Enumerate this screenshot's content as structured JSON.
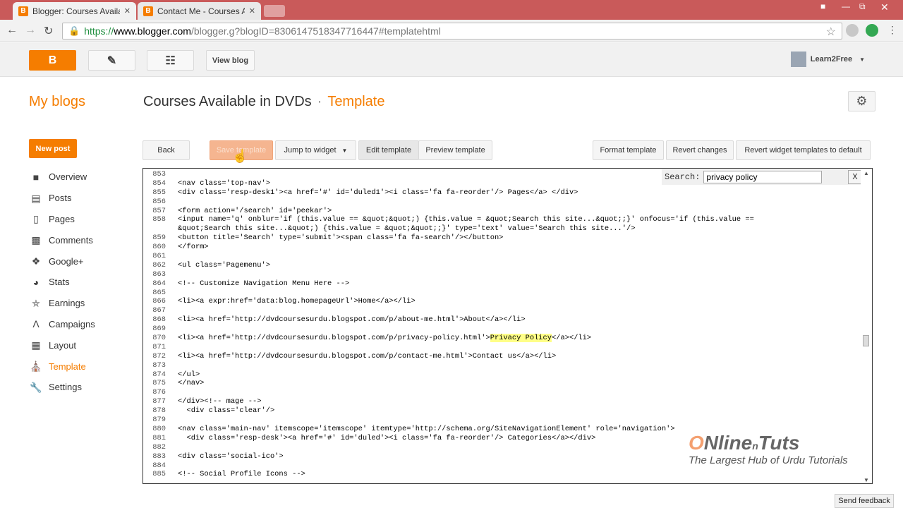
{
  "browser": {
    "tabs": [
      {
        "label": "Blogger: Courses Availabl",
        "active": true
      },
      {
        "label": "Contact Me - Courses Ava",
        "active": false
      }
    ],
    "url_https": "https://",
    "url_host": "www.blogger.com",
    "url_path": "/blogger.g?blogID=8306147518347716447#templatehtml"
  },
  "topbar": {
    "logo": "B",
    "view_blog": "View blog",
    "user": "Learn2Free"
  },
  "header": {
    "my_blogs": "My blogs",
    "blog_name": "Courses Available in DVDs",
    "separator": "·",
    "page": "Template"
  },
  "sidebar": {
    "new_post": "New post",
    "items": [
      {
        "label": "Overview",
        "icon": "overview-icon"
      },
      {
        "label": "Posts",
        "icon": "posts-icon"
      },
      {
        "label": "Pages",
        "icon": "pages-icon"
      },
      {
        "label": "Comments",
        "icon": "comments-icon"
      },
      {
        "label": "Google+",
        "icon": "google-plus-icon"
      },
      {
        "label": "Stats",
        "icon": "stats-icon"
      },
      {
        "label": "Earnings",
        "icon": "earnings-icon"
      },
      {
        "label": "Campaigns",
        "icon": "campaigns-icon"
      },
      {
        "label": "Layout",
        "icon": "layout-icon"
      },
      {
        "label": "Template",
        "icon": "template-icon"
      },
      {
        "label": "Settings",
        "icon": "settings-icon"
      }
    ]
  },
  "toolbar": {
    "back": "Back",
    "save": "Save template",
    "jump": "Jump to widget",
    "edit": "Edit template",
    "preview": "Preview template",
    "format": "Format template",
    "revert": "Revert changes",
    "revert_widgets": "Revert widget templates to default"
  },
  "search": {
    "label": "Search:",
    "value": "privacy policy",
    "close": "X"
  },
  "code_lines": [
    {
      "no": "853",
      "code": ""
    },
    {
      "no": "854",
      "code": "<nav class='top-nav'>"
    },
    {
      "no": "855",
      "code": "<div class='resp-desk1'><a href='#' id='duled1'><i class='fa fa-reorder'/> Pages</a> </div>"
    },
    {
      "no": "856",
      "code": ""
    },
    {
      "no": "857",
      "code": "<form action='/search' id='peekar'>"
    },
    {
      "no": "858",
      "code": "<input name='q' onblur='if (this.value == &quot;&quot;) {this.value = &quot;Search this site...&quot;;}' onfocus='if (this.value =="
    },
    {
      "no": "",
      "code": "&quot;Search this site...&quot;) {this.value = &quot;&quot;;}' type='text' value='Search this site...'/>"
    },
    {
      "no": "859",
      "code": "<button title='Search' type='submit'><span class='fa fa-search'/></button>"
    },
    {
      "no": "860",
      "code": "</form>"
    },
    {
      "no": "861",
      "code": ""
    },
    {
      "no": "862",
      "code": "<ul class='Pagemenu'>"
    },
    {
      "no": "863",
      "code": ""
    },
    {
      "no": "864",
      "code": "<!-- Customize Navigation Menu Here -->"
    },
    {
      "no": "865",
      "code": ""
    },
    {
      "no": "866",
      "code": "<li><a expr:href='data:blog.homepageUrl'>Home</a></li>"
    },
    {
      "no": "867",
      "code": ""
    },
    {
      "no": "868",
      "code": "<li><a href='http://dvdcoursesurdu.blogspot.com/p/about-me.html'>About</a></li>"
    },
    {
      "no": "869",
      "code": ""
    },
    {
      "no": "870",
      "code_pre": "<li><a href='http://dvdcoursesurdu.blogspot.com/p/privacy-policy.html'>",
      "code_hl": "Privacy Policy",
      "code_post": "</a></li>"
    },
    {
      "no": "871",
      "code": ""
    },
    {
      "no": "872",
      "code": "<li><a href='http://dvdcoursesurdu.blogspot.com/p/contact-me.html'>Contact us</a></li>"
    },
    {
      "no": "873",
      "code": ""
    },
    {
      "no": "874",
      "code": "</ul>"
    },
    {
      "no": "875",
      "code": "</nav>"
    },
    {
      "no": "876",
      "code": ""
    },
    {
      "no": "877",
      "code": "</div><!-- mage -->"
    },
    {
      "no": "878",
      "code": "  <div class='clear'/>"
    },
    {
      "no": "879",
      "code": ""
    },
    {
      "no": "880",
      "code": "<nav class='main-nav' itemscope='itemscope' itemtype='http://schema.org/SiteNavigationElement' role='navigation'>"
    },
    {
      "no": "881",
      "code": "  <div class='resp-desk'><a href='#' id='duled'><i class='fa fa-reorder'/> Categories</a></div>"
    },
    {
      "no": "882",
      "code": ""
    },
    {
      "no": "883",
      "code": "<div class='social-ico'>"
    },
    {
      "no": "884",
      "code": ""
    },
    {
      "no": "885",
      "code": "<!-- Social Profile Icons -->"
    }
  ],
  "footer": {
    "feedback": "Send feedback"
  },
  "watermark": {
    "line1_a": "O",
    "line1_b": "Nline",
    "line1_c": "Tuts",
    "line2": "The Largest Hub of Urdu Tutorials"
  },
  "colors": {
    "accent": "#f57d00",
    "chrome_frame": "#c95a5a",
    "highlight": "#ffff88"
  }
}
